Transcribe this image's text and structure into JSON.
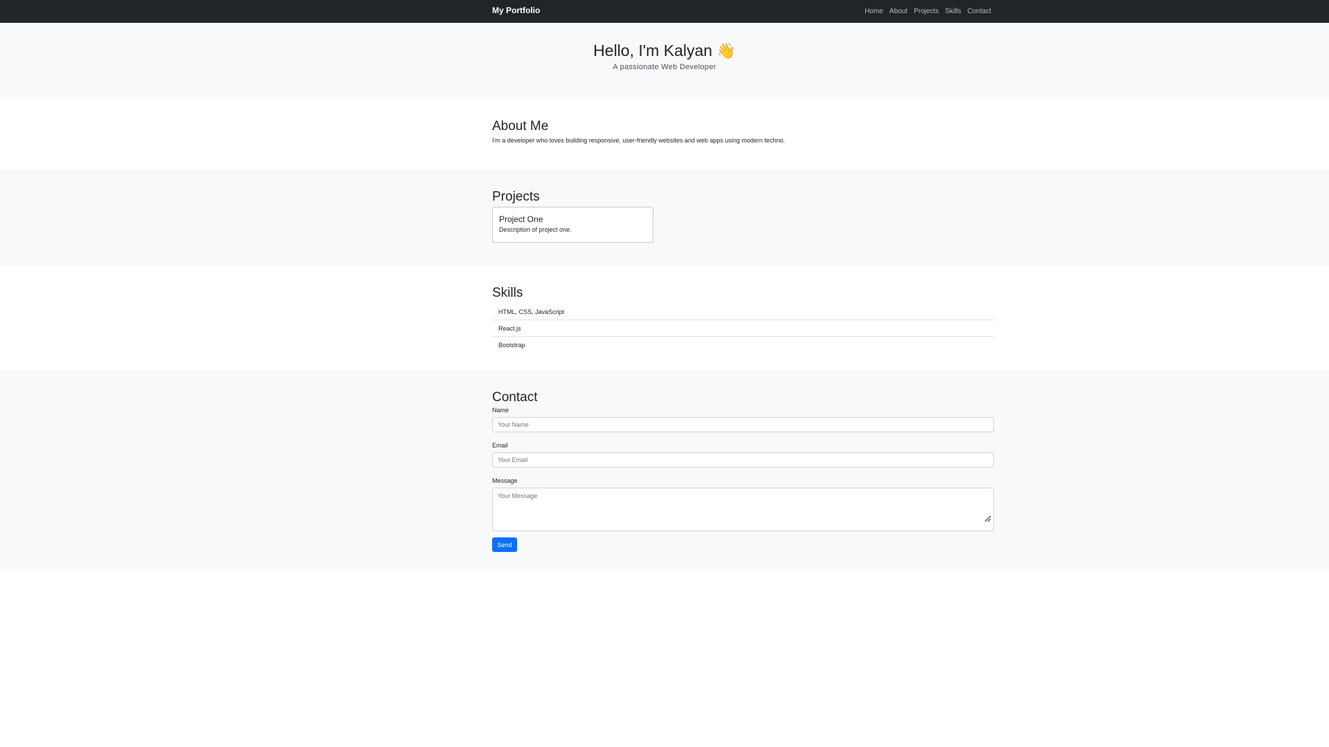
{
  "navbar": {
    "brand": "My Portfolio",
    "links": [
      "Home",
      "About",
      "Projects",
      "Skills",
      "Contact"
    ]
  },
  "hero": {
    "title": "Hello, I'm Kalyan",
    "emoji": "👋",
    "subtitle": "A passionate Web Developer"
  },
  "about": {
    "heading": "About Me",
    "text": "I'm a developer who loves building responsive, user-friendly websites and web apps using modern techno."
  },
  "projects": {
    "heading": "Projects",
    "items": [
      {
        "title": "Project One",
        "description": "Description of project one."
      }
    ]
  },
  "skills": {
    "heading": "Skills",
    "items": [
      "HTML, CSS, JavaScript",
      "React.js",
      "Bootstrap"
    ]
  },
  "contact": {
    "heading": "Contact",
    "name_label": "Name",
    "name_placeholder": "Your Name",
    "email_label": "Email",
    "email_placeholder": "Your Email",
    "message_label": "Message",
    "message_placeholder": "Your Message",
    "send_label": "Send"
  },
  "colors": {
    "navbar_bg": "#212529",
    "section_alt_bg": "#f8f9fa",
    "primary": "#0d6efd"
  }
}
